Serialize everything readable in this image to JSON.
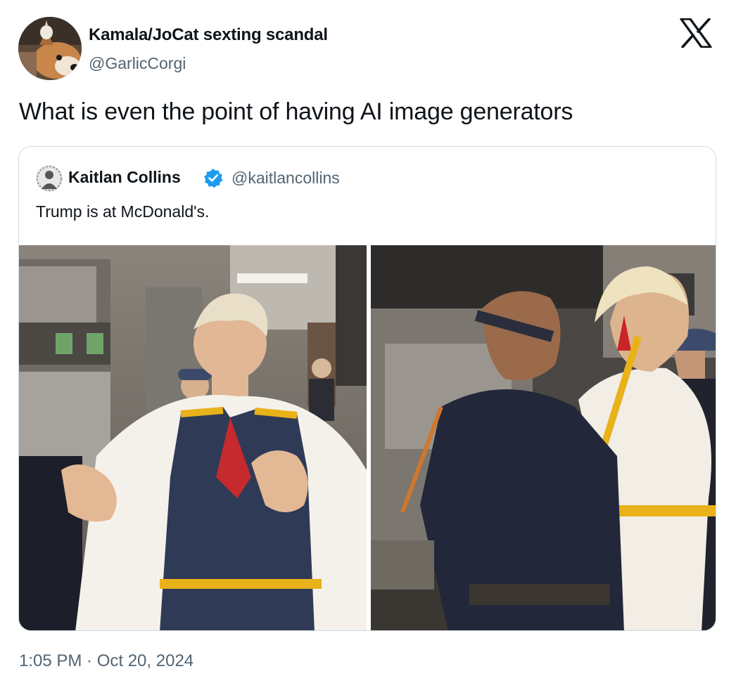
{
  "author": {
    "display_name": "Kamala/JoCat sexting scandal",
    "handle": "@GarlicCorgi",
    "avatar_icon": "corgi-avatar"
  },
  "tweet": {
    "text": "What is even the point of having AI image generators",
    "timestamp": "1:05 PM · Oct 20, 2024"
  },
  "quoted_tweet": {
    "display_name": "Kaitlan Collins",
    "verified": true,
    "handle": "@kaitlancollins",
    "text": "Trump is at McDonald's.",
    "media": [
      {
        "icon": "photo-kitchen-left"
      },
      {
        "icon": "photo-kitchen-right"
      }
    ]
  },
  "brand": {
    "logo": "x-logo",
    "verified_color": "#1d9bf0",
    "text_color": "#0f1419",
    "secondary_text_color": "#536471",
    "border_color": "#cfd9de"
  }
}
